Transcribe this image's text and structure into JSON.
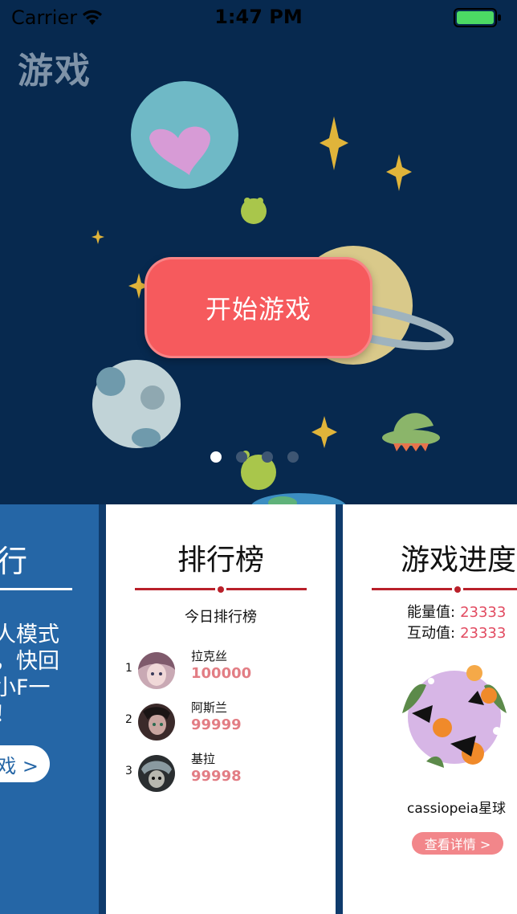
{
  "status_bar": {
    "carrier": "Carrier",
    "time": "1:47 PM",
    "battery_color": "#4cd964"
  },
  "page": {
    "title": "游戏"
  },
  "hero": {
    "start_button_label": "开始游戏",
    "button_color": "#f65a5d",
    "pager_count": 4,
    "pager_active": 0
  },
  "cards": {
    "mode_card": {
      "title": "进行",
      "description": "单人模式戏，快回和小F一吧！",
      "description_lines": [
        "单人模式",
        "戏，快回",
        "和小F一",
        "吧！"
      ],
      "more_label": "戏 >"
    },
    "ranking": {
      "title": "排行榜",
      "subtitle": "今日排行榜",
      "rows": [
        {
          "rank": "1",
          "name": "拉克丝",
          "score": "100000"
        },
        {
          "rank": "2",
          "name": "阿斯兰",
          "score": "99999"
        },
        {
          "rank": "3",
          "name": "基拉",
          "score": "99998"
        }
      ]
    },
    "progress": {
      "title": "游戏进度",
      "energy_label": "能量值:",
      "energy_value": "23333",
      "interaction_label": "互动值:",
      "interaction_value": "23333",
      "planet_name": "cassiopeia星球",
      "detail_label": "查看详情 >"
    }
  },
  "colors": {
    "background": "#072a54",
    "accent_red": "#b9202a",
    "score_pink": "#e27d84",
    "mode_card_blue": "#2566a6"
  }
}
